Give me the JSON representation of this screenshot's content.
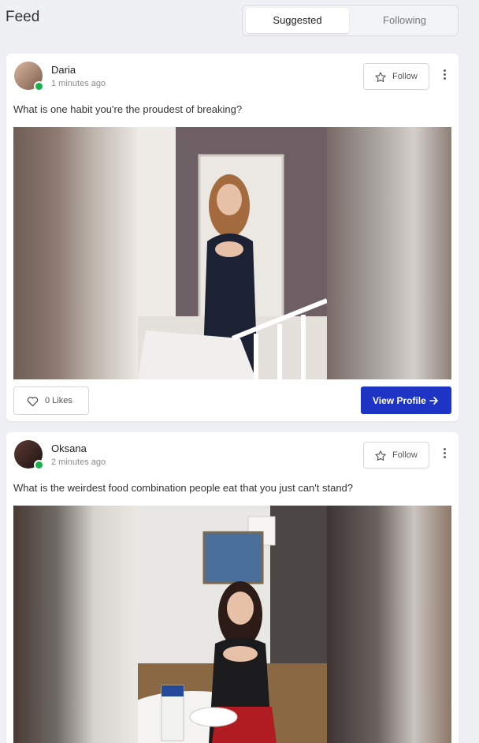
{
  "header": {
    "title": "Feed",
    "tabs": [
      {
        "label": "Suggested",
        "active": true
      },
      {
        "label": "Following",
        "active": false
      }
    ]
  },
  "colors": {
    "accent": "#1d34c4",
    "online": "#16b24a",
    "background": "#eff0f4"
  },
  "posts": [
    {
      "user": "Daria",
      "time": "1 minutes ago",
      "online": true,
      "follow_label": "Follow",
      "question": "What is one habit you're the proudest of breaking?",
      "likes_label": "0 Likes",
      "view_label": "View Profile"
    },
    {
      "user": "Oksana",
      "time": "2 minutes ago",
      "online": true,
      "follow_label": "Follow",
      "question": "What is the weirdest food combination people eat that you just can't stand?"
    }
  ],
  "icons": [
    "star-icon",
    "kebab-menu-icon",
    "heart-icon",
    "arrow-right-icon",
    "online-status-icon"
  ]
}
